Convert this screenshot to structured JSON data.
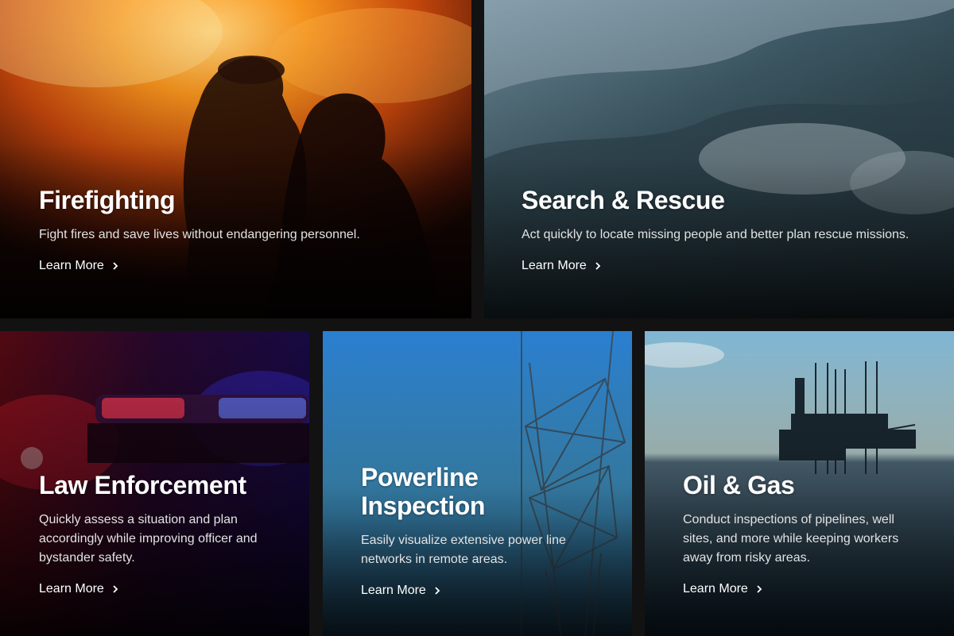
{
  "cards": [
    {
      "title": "Firefighting",
      "description": "Fight fires and save lives without endangering personnel.",
      "link": "Learn More"
    },
    {
      "title": "Search & Rescue",
      "description": "Act quickly to locate missing people and better plan rescue missions.",
      "link": "Learn More"
    },
    {
      "title": "Law Enforcement",
      "description": "Quickly assess a situation and plan accordingly while improving officer and bystander safety.",
      "link": "Learn More"
    },
    {
      "title": "Powerline Inspection",
      "description": "Easily visualize extensive power line networks in remote areas.",
      "link": "Learn More"
    },
    {
      "title": "Oil & Gas",
      "description": "Conduct inspections of pipelines, well sites, and more while keeping workers away from risky areas.",
      "link": "Learn More"
    }
  ],
  "icons": {
    "link_arrow": "chevron-right-icon"
  },
  "colors": {
    "page_bg": "#121212",
    "text": "#ffffff",
    "muted_text": "#e2e2e2"
  }
}
